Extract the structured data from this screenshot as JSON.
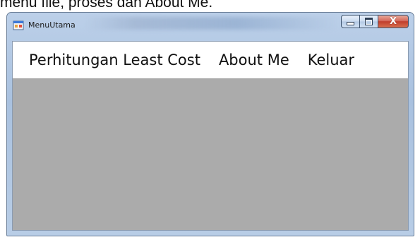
{
  "caption": "menu file, proses dan About Me.",
  "window": {
    "title": "MenuUtama",
    "controls": {
      "minimize": "minimize",
      "maximize": "maximize",
      "close_glyph": "X"
    }
  },
  "menu": {
    "items": [
      {
        "label": "Perhitungan Least Cost"
      },
      {
        "label": "About Me"
      },
      {
        "label": "Keluar"
      }
    ]
  },
  "colors": {
    "client_background": "#ababab",
    "menubar_background": "#ffffff",
    "close_button": "#c03d2c"
  },
  "icons": {
    "app": "windows-form-icon"
  }
}
